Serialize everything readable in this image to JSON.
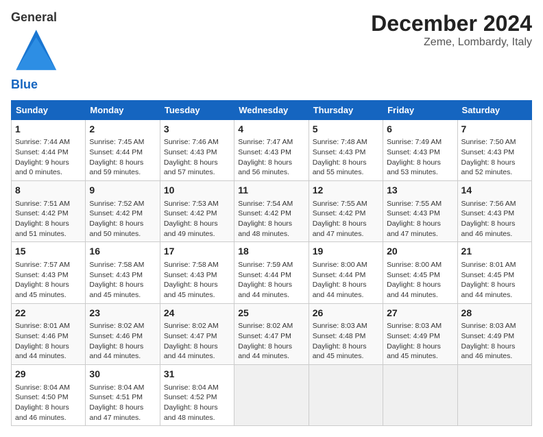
{
  "header": {
    "logo_general": "General",
    "logo_blue": "Blue",
    "month_title": "December 2024",
    "location": "Zeme, Lombardy, Italy"
  },
  "weekdays": [
    "Sunday",
    "Monday",
    "Tuesday",
    "Wednesday",
    "Thursday",
    "Friday",
    "Saturday"
  ],
  "weeks": [
    [
      {
        "day": "1",
        "info": "Sunrise: 7:44 AM\nSunset: 4:44 PM\nDaylight: 9 hours\nand 0 minutes."
      },
      {
        "day": "2",
        "info": "Sunrise: 7:45 AM\nSunset: 4:44 PM\nDaylight: 8 hours\nand 59 minutes."
      },
      {
        "day": "3",
        "info": "Sunrise: 7:46 AM\nSunset: 4:43 PM\nDaylight: 8 hours\nand 57 minutes."
      },
      {
        "day": "4",
        "info": "Sunrise: 7:47 AM\nSunset: 4:43 PM\nDaylight: 8 hours\nand 56 minutes."
      },
      {
        "day": "5",
        "info": "Sunrise: 7:48 AM\nSunset: 4:43 PM\nDaylight: 8 hours\nand 55 minutes."
      },
      {
        "day": "6",
        "info": "Sunrise: 7:49 AM\nSunset: 4:43 PM\nDaylight: 8 hours\nand 53 minutes."
      },
      {
        "day": "7",
        "info": "Sunrise: 7:50 AM\nSunset: 4:43 PM\nDaylight: 8 hours\nand 52 minutes."
      }
    ],
    [
      {
        "day": "8",
        "info": "Sunrise: 7:51 AM\nSunset: 4:42 PM\nDaylight: 8 hours\nand 51 minutes."
      },
      {
        "day": "9",
        "info": "Sunrise: 7:52 AM\nSunset: 4:42 PM\nDaylight: 8 hours\nand 50 minutes."
      },
      {
        "day": "10",
        "info": "Sunrise: 7:53 AM\nSunset: 4:42 PM\nDaylight: 8 hours\nand 49 minutes."
      },
      {
        "day": "11",
        "info": "Sunrise: 7:54 AM\nSunset: 4:42 PM\nDaylight: 8 hours\nand 48 minutes."
      },
      {
        "day": "12",
        "info": "Sunrise: 7:55 AM\nSunset: 4:42 PM\nDaylight: 8 hours\nand 47 minutes."
      },
      {
        "day": "13",
        "info": "Sunrise: 7:55 AM\nSunset: 4:43 PM\nDaylight: 8 hours\nand 47 minutes."
      },
      {
        "day": "14",
        "info": "Sunrise: 7:56 AM\nSunset: 4:43 PM\nDaylight: 8 hours\nand 46 minutes."
      }
    ],
    [
      {
        "day": "15",
        "info": "Sunrise: 7:57 AM\nSunset: 4:43 PM\nDaylight: 8 hours\nand 45 minutes."
      },
      {
        "day": "16",
        "info": "Sunrise: 7:58 AM\nSunset: 4:43 PM\nDaylight: 8 hours\nand 45 minutes."
      },
      {
        "day": "17",
        "info": "Sunrise: 7:58 AM\nSunset: 4:43 PM\nDaylight: 8 hours\nand 45 minutes."
      },
      {
        "day": "18",
        "info": "Sunrise: 7:59 AM\nSunset: 4:44 PM\nDaylight: 8 hours\nand 44 minutes."
      },
      {
        "day": "19",
        "info": "Sunrise: 8:00 AM\nSunset: 4:44 PM\nDaylight: 8 hours\nand 44 minutes."
      },
      {
        "day": "20",
        "info": "Sunrise: 8:00 AM\nSunset: 4:45 PM\nDaylight: 8 hours\nand 44 minutes."
      },
      {
        "day": "21",
        "info": "Sunrise: 8:01 AM\nSunset: 4:45 PM\nDaylight: 8 hours\nand 44 minutes."
      }
    ],
    [
      {
        "day": "22",
        "info": "Sunrise: 8:01 AM\nSunset: 4:46 PM\nDaylight: 8 hours\nand 44 minutes."
      },
      {
        "day": "23",
        "info": "Sunrise: 8:02 AM\nSunset: 4:46 PM\nDaylight: 8 hours\nand 44 minutes."
      },
      {
        "day": "24",
        "info": "Sunrise: 8:02 AM\nSunset: 4:47 PM\nDaylight: 8 hours\nand 44 minutes."
      },
      {
        "day": "25",
        "info": "Sunrise: 8:02 AM\nSunset: 4:47 PM\nDaylight: 8 hours\nand 44 minutes."
      },
      {
        "day": "26",
        "info": "Sunrise: 8:03 AM\nSunset: 4:48 PM\nDaylight: 8 hours\nand 45 minutes."
      },
      {
        "day": "27",
        "info": "Sunrise: 8:03 AM\nSunset: 4:49 PM\nDaylight: 8 hours\nand 45 minutes."
      },
      {
        "day": "28",
        "info": "Sunrise: 8:03 AM\nSunset: 4:49 PM\nDaylight: 8 hours\nand 46 minutes."
      }
    ],
    [
      {
        "day": "29",
        "info": "Sunrise: 8:04 AM\nSunset: 4:50 PM\nDaylight: 8 hours\nand 46 minutes."
      },
      {
        "day": "30",
        "info": "Sunrise: 8:04 AM\nSunset: 4:51 PM\nDaylight: 8 hours\nand 47 minutes."
      },
      {
        "day": "31",
        "info": "Sunrise: 8:04 AM\nSunset: 4:52 PM\nDaylight: 8 hours\nand 48 minutes."
      },
      null,
      null,
      null,
      null
    ]
  ]
}
